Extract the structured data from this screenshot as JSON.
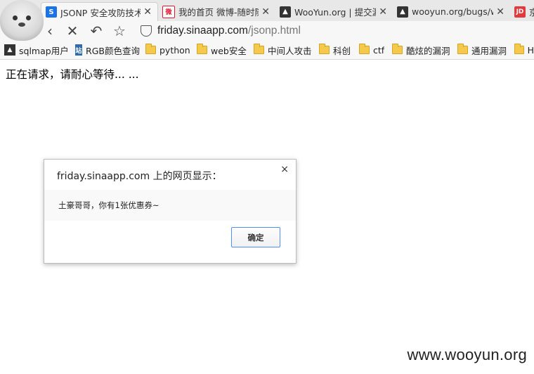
{
  "tabs": [
    {
      "title": "JSONP 安全攻防技术",
      "icon": "s-logo-icon",
      "color": "#1a73e8",
      "active": true
    },
    {
      "title": "我的首页 微博-随时随",
      "icon": "weibo-icon",
      "color": "#e6162d"
    },
    {
      "title": "WooYun.org | 提交漏",
      "icon": "wooyun-icon",
      "color": "#333333"
    },
    {
      "title": "wooyun.org/bugs/w",
      "icon": "wooyun-icon",
      "color": "#333333"
    },
    {
      "title": "京",
      "icon": "jd-icon",
      "color": "#e4393c"
    }
  ],
  "toolbar": {
    "url_host": "friday.sinaapp.com",
    "url_path": "/jsonp.html"
  },
  "bookmarks": [
    {
      "label": "sqlmap用户",
      "icon": "wooyun-icon"
    },
    {
      "label": "RGB颜色查询",
      "icon": "site-icon"
    },
    {
      "label": "python",
      "icon": "folder-icon"
    },
    {
      "label": "web安全",
      "icon": "folder-icon"
    },
    {
      "label": "中间人攻击",
      "icon": "folder-icon"
    },
    {
      "label": "科创",
      "icon": "folder-icon"
    },
    {
      "label": "ctf",
      "icon": "folder-icon"
    },
    {
      "label": "酷炫的漏洞",
      "icon": "folder-icon"
    },
    {
      "label": "通用漏洞",
      "icon": "folder-icon"
    },
    {
      "label": "H",
      "icon": "folder-icon"
    }
  ],
  "page": {
    "loading_text": "正在请求，请耐心等待... ..."
  },
  "dialog": {
    "title": "friday.sinaapp.com 上的网页显示：",
    "close": "×",
    "message": "土豪哥哥，你有1张优惠券~",
    "ok_label": "确定"
  },
  "watermark": "www.wooyun.org"
}
